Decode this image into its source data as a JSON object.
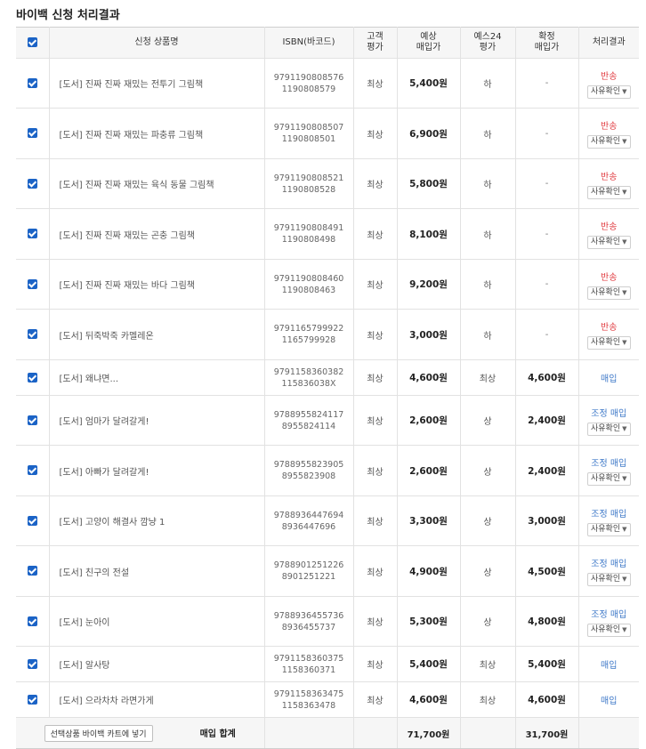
{
  "page_title": "바이백 신청 처리결과",
  "headers": {
    "product": "신청 상품명",
    "isbn": "ISBN(바코드)",
    "customer_grade": [
      "고객",
      "평가"
    ],
    "expected_price": [
      "예상",
      "매입가"
    ],
    "yes24_grade": [
      "예스24",
      "평가"
    ],
    "final_price": [
      "확정",
      "매입가"
    ],
    "result": "처리결과"
  },
  "rows": [
    {
      "name": "[도서] 진짜 진짜 재밌는 전투기 그림책",
      "isbn13": "9791190808576",
      "isbn10": "1190808579",
      "customer": "최상",
      "expected": "5,400원",
      "yes24": "하",
      "final": "-",
      "result": "반송",
      "result_color": "red",
      "select": "사유확인"
    },
    {
      "name": "[도서] 진짜 진짜 재밌는 파충류 그림책",
      "isbn13": "9791190808507",
      "isbn10": "1190808501",
      "customer": "최상",
      "expected": "6,900원",
      "yes24": "하",
      "final": "-",
      "result": "반송",
      "result_color": "red",
      "select": "사유확인"
    },
    {
      "name": "[도서] 진짜 진짜 재밌는 육식 동물 그림책",
      "isbn13": "9791190808521",
      "isbn10": "1190808528",
      "customer": "최상",
      "expected": "5,800원",
      "yes24": "하",
      "final": "-",
      "result": "반송",
      "result_color": "red",
      "select": "사유확인"
    },
    {
      "name": "[도서] 진짜 진짜 재밌는 곤충 그림책",
      "isbn13": "9791190808491",
      "isbn10": "1190808498",
      "customer": "최상",
      "expected": "8,100원",
      "yes24": "하",
      "final": "-",
      "result": "반송",
      "result_color": "red",
      "select": "사유확인"
    },
    {
      "name": "[도서] 진짜 진짜 재밌는 바다 그림책",
      "isbn13": "9791190808460",
      "isbn10": "1190808463",
      "customer": "최상",
      "expected": "9,200원",
      "yes24": "하",
      "final": "-",
      "result": "반송",
      "result_color": "red",
      "select": "사유확인"
    },
    {
      "name": "[도서] 뒤죽박죽 카멜레온",
      "isbn13": "9791165799922",
      "isbn10": "1165799928",
      "customer": "최상",
      "expected": "3,000원",
      "yes24": "하",
      "final": "-",
      "result": "반송",
      "result_color": "red",
      "select": "사유확인"
    },
    {
      "name": "[도서] 왜냐면...",
      "isbn13": "9791158360382",
      "isbn10": "115836038X",
      "customer": "최상",
      "expected": "4,600원",
      "yes24": "최상",
      "final": "4,600원",
      "result": "매입",
      "result_color": "blue",
      "select": ""
    },
    {
      "name": "[도서] 엄마가 달려갈게!",
      "isbn13": "9788955824117",
      "isbn10": "8955824114",
      "customer": "최상",
      "expected": "2,600원",
      "yes24": "상",
      "final": "2,400원",
      "result": "조정 매입",
      "result_color": "blue",
      "select": "사유확인"
    },
    {
      "name": "[도서] 아빠가 달려갈게!",
      "isbn13": "9788955823905",
      "isbn10": "8955823908",
      "customer": "최상",
      "expected": "2,600원",
      "yes24": "상",
      "final": "2,400원",
      "result": "조정 매입",
      "result_color": "blue",
      "select": "사유확인"
    },
    {
      "name": "[도서] 고양이 해결사 깜냥 1",
      "isbn13": "9788936447694",
      "isbn10": "8936447696",
      "customer": "최상",
      "expected": "3,300원",
      "yes24": "상",
      "final": "3,000원",
      "result": "조정 매입",
      "result_color": "blue",
      "select": "사유확인"
    },
    {
      "name": "[도서] 친구의 전설",
      "isbn13": "9788901251226",
      "isbn10": "8901251221",
      "customer": "최상",
      "expected": "4,900원",
      "yes24": "상",
      "final": "4,500원",
      "result": "조정 매입",
      "result_color": "blue",
      "select": "사유확인"
    },
    {
      "name": "[도서] 눈아이",
      "isbn13": "9788936455736",
      "isbn10": "8936455737",
      "customer": "최상",
      "expected": "5,300원",
      "yes24": "상",
      "final": "4,800원",
      "result": "조정 매입",
      "result_color": "blue",
      "select": "사유확인"
    },
    {
      "name": "[도서] 알사탕",
      "isbn13": "9791158360375",
      "isbn10": "1158360371",
      "customer": "최상",
      "expected": "5,400원",
      "yes24": "최상",
      "final": "5,400원",
      "result": "매입",
      "result_color": "blue",
      "select": ""
    },
    {
      "name": "[도서] 으라차차 라면가게",
      "isbn13": "9791158363475",
      "isbn10": "1158363478",
      "customer": "최상",
      "expected": "4,600원",
      "yes24": "최상",
      "final": "4,600원",
      "result": "매입",
      "result_color": "blue",
      "select": ""
    }
  ],
  "footer": {
    "cart_button": "선택상품 바이백 카트에 넣기",
    "total_label": "매입 합계",
    "expected_total": "71,700원",
    "final_total": "31,700원"
  },
  "colors": {
    "checkbox": "#1b63c6",
    "returned": "#e0393e",
    "purchased": "#3f79c8"
  }
}
